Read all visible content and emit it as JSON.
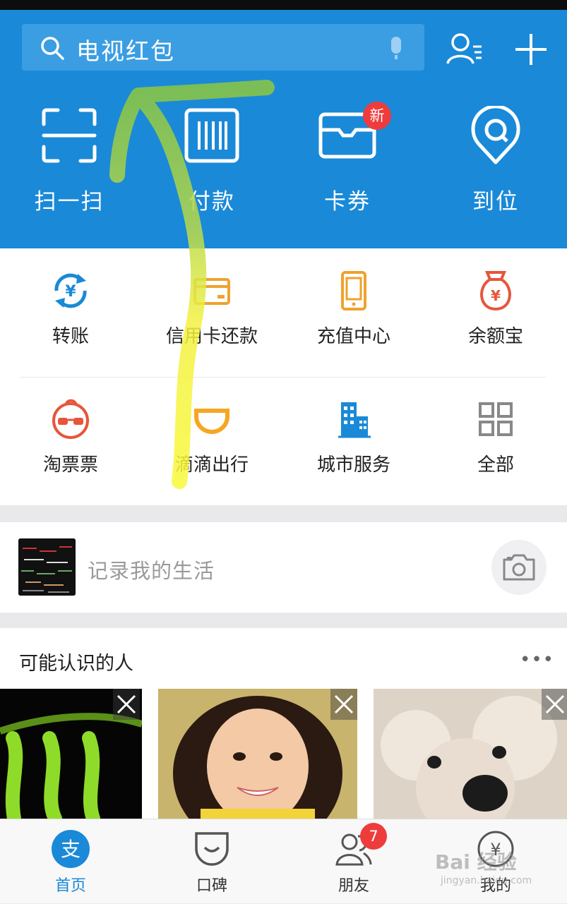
{
  "search": {
    "placeholder": "电视红包"
  },
  "quick_actions": [
    {
      "label": "扫一扫",
      "icon": "scan-icon"
    },
    {
      "label": "付款",
      "icon": "barcode-icon"
    },
    {
      "label": "卡券",
      "icon": "card-wallet-icon",
      "badge": "新"
    },
    {
      "label": "到位",
      "icon": "location-pin-icon"
    }
  ],
  "services": [
    {
      "label": "转账",
      "icon": "transfer-icon",
      "color": "#1a8ad8"
    },
    {
      "label": "信用卡还款",
      "icon": "credit-card-icon",
      "color": "#f0a22e"
    },
    {
      "label": "充值中心",
      "icon": "phone-icon",
      "color": "#f0a22e"
    },
    {
      "label": "余额宝",
      "icon": "money-bag-icon",
      "color": "#e5563b"
    },
    {
      "label": "淘票票",
      "icon": "glasses-face-icon",
      "color": "#e5563b"
    },
    {
      "label": "滴滴出行",
      "icon": "didi-icon",
      "color": "#f5a623"
    },
    {
      "label": "城市服务",
      "icon": "building-icon",
      "color": "#1a8ad8"
    },
    {
      "label": "全部",
      "icon": "grid-icon",
      "color": "#888888"
    }
  ],
  "life": {
    "placeholder": "记录我的生活"
  },
  "people": {
    "title": "可能认识的人",
    "more": "•••"
  },
  "tabs": [
    {
      "label": "首页",
      "icon": "alipay-home-icon",
      "active": true
    },
    {
      "label": "口碑",
      "icon": "koubei-icon"
    },
    {
      "label": "朋友",
      "icon": "friends-icon",
      "badge": "7"
    },
    {
      "label": "我的",
      "icon": "my-wallet-icon"
    }
  ],
  "watermark": {
    "line1": "Bai 经验",
    "line2": "jingyan.baidu.com"
  },
  "colors": {
    "primary": "#1989d8",
    "badge": "#ee3b3b"
  }
}
